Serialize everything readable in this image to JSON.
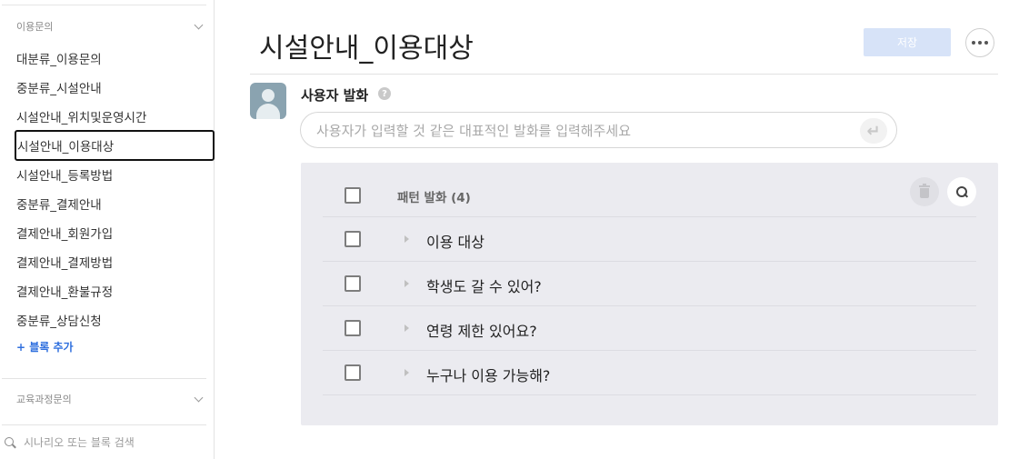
{
  "sidebar": {
    "group1_label": "이용문의",
    "items": [
      {
        "label": "대분류_이용문의"
      },
      {
        "label": "중분류_시설안내"
      },
      {
        "label": "시설안내_위치및운영시간"
      },
      {
        "label": "시설안내_이용대상",
        "active": true
      },
      {
        "label": "시설안내_등록방법"
      },
      {
        "label": "중분류_결제안내"
      },
      {
        "label": "결제안내_회원가입"
      },
      {
        "label": "결제안내_결제방법"
      },
      {
        "label": "결제안내_환불규정"
      },
      {
        "label": "중분류_상담신청"
      }
    ],
    "add_block_label": "+ 블록 추가",
    "group2_label": "교육과정문의",
    "search_placeholder": "시나리오 또는 블록 검색"
  },
  "main": {
    "title": "시설안내_이용대상",
    "save_label": "저장",
    "user_utterance_label": "사용자 발화",
    "help_glyph": "?",
    "utterance_placeholder": "사용자가 입력할 것 같은 대표적인 발화를 입력해주세요",
    "enter_glyph": "↵",
    "pattern_header": "패턴 발화 (4)",
    "patterns": [
      "이용 대상",
      "학생도 갈 수 있어?",
      "연령 제한 있어요?",
      "누구나 이용 가능해?"
    ]
  },
  "colors": {
    "accent": "#2f6fde",
    "save_button_bg": "#d7e3f8",
    "panel_bg": "#ebebf0",
    "avatar_bg": "#8aa3b0"
  },
  "icons": {
    "sidebar_chevron": "chevron-down-icon",
    "search": "search-icon",
    "more": "more-icon",
    "help": "help-icon",
    "enter": "enter-icon",
    "trash": "trash-icon",
    "expand": "caret-right-icon",
    "avatar": "user-avatar-icon"
  }
}
